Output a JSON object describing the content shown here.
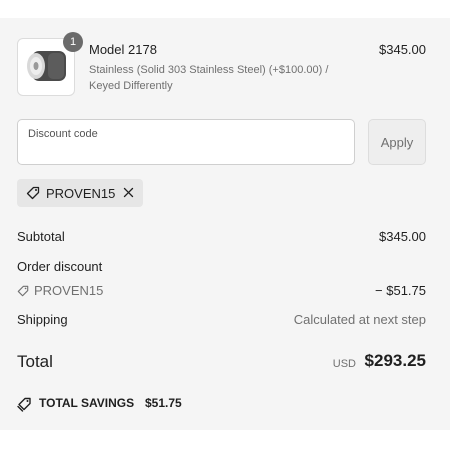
{
  "product": {
    "name": "Model 2178",
    "variant": "Stainless (Solid 303 Stainless Steel) (+$100.00) / Keyed Differently",
    "price": "$345.00",
    "quantity": "1"
  },
  "discount": {
    "label": "Discount code",
    "value": "",
    "apply_label": "Apply",
    "applied_code": "PROVEN15"
  },
  "summary": {
    "subtotal_label": "Subtotal",
    "subtotal_value": "$345.00",
    "order_discount_label": "Order discount",
    "discount_code": "PROVEN15",
    "discount_value": "− $51.75",
    "shipping_label": "Shipping",
    "shipping_value": "Calculated at next step",
    "total_label": "Total",
    "currency": "USD",
    "total_value": "$293.25",
    "savings_label": "TOTAL SAVINGS",
    "savings_value": "$51.75"
  },
  "icons": {
    "tag": "tag-icon",
    "close": "close-icon",
    "savings": "savings-tag-icon"
  },
  "colors": {
    "panel_bg": "#f5f5f5",
    "muted_text": "#707070",
    "chip_bg": "#e6e6e6",
    "badge_bg": "#6b6b6b"
  }
}
